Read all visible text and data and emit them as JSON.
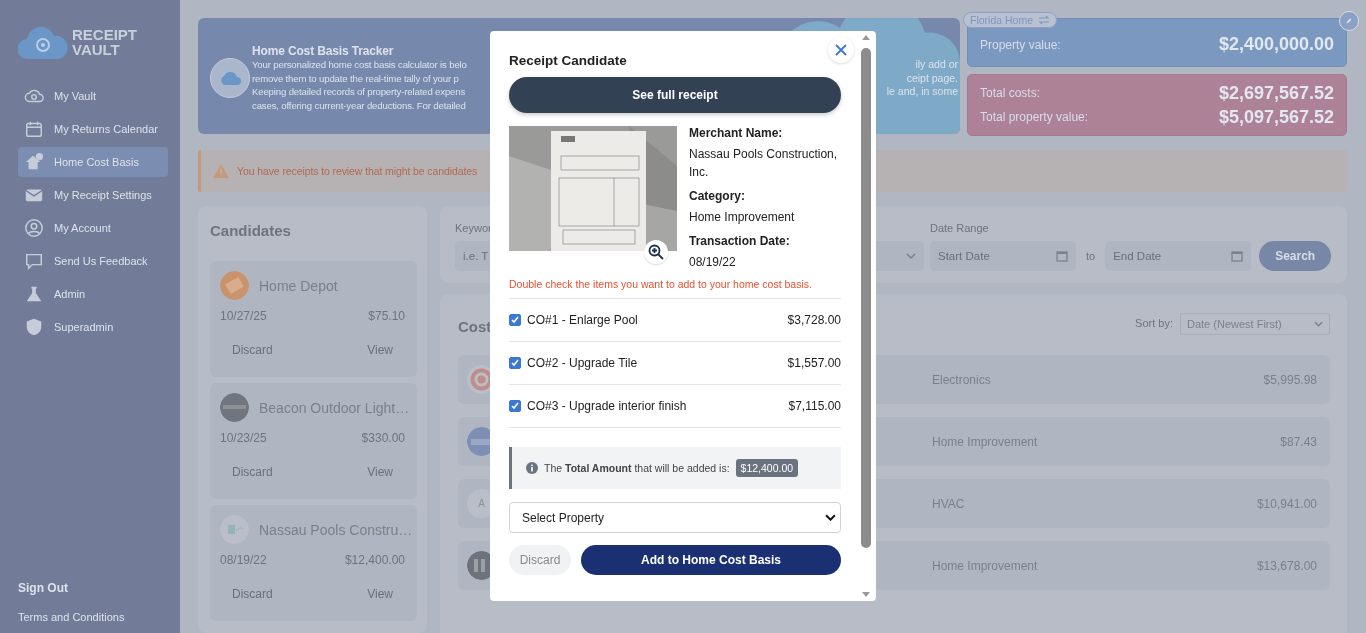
{
  "sidebar": {
    "logo_lines": [
      "RECEIPT",
      "VAULT"
    ],
    "items": [
      {
        "label": "My Vault",
        "kind": "vault",
        "selected": false
      },
      {
        "label": "My Returns Calendar",
        "kind": "calendar",
        "selected": false
      },
      {
        "label": "Home Cost Basis",
        "kind": "house",
        "selected": true
      },
      {
        "label": "My Receipt Settings",
        "kind": "mail",
        "selected": false
      },
      {
        "label": "My Account",
        "kind": "user",
        "selected": false
      },
      {
        "label": "Send Us Feedback",
        "kind": "chat",
        "selected": false
      },
      {
        "label": "Admin",
        "kind": "flask",
        "selected": false
      },
      {
        "label": "Superadmin",
        "kind": "shield",
        "selected": false
      }
    ],
    "sign_out": "Sign Out",
    "terms": "Terms and Conditions"
  },
  "hero": {
    "title": "Home Cost Basis Tracker",
    "lines_left": [
      "Your personalized home cost basis calculator is belo",
      "remove them to update the real-time tally of your p",
      "Keeping detailed records of property-related expens",
      "cases, offering current-year deductions. For detailed"
    ],
    "lines_right": [
      "ily add or",
      "ceipt page.",
      "le and, in some"
    ]
  },
  "property": {
    "name": "Florida Home",
    "value_label": "Property value:",
    "value": "$2,400,000.00",
    "totals": [
      {
        "label": "Total costs:",
        "value": "$2,697,567.52"
      },
      {
        "label": "Total property value:",
        "value": "$5,097,567.52"
      }
    ]
  },
  "alert": {
    "text": "You have receipts to review that might be candidates"
  },
  "candidates": {
    "title": "Candidates",
    "items": [
      {
        "merchant": "Home Depot",
        "kind": "orange",
        "date": "10/27/25",
        "amount": "$75.10",
        "discard": "Discard",
        "view": "View"
      },
      {
        "merchant": "Beacon Outdoor Light…",
        "kind": "dark",
        "date": "10/23/25",
        "amount": "$330.00",
        "discard": "Discard",
        "view": "View"
      },
      {
        "merchant": "Nassau Pools Constru…",
        "kind": "light",
        "date": "08/19/22",
        "amount": "$12,400.00",
        "discard": "Discard",
        "view": "View"
      }
    ]
  },
  "filters": {
    "keyword_label": "Keywor",
    "keyword_placeholder": "i.e. T",
    "date_label": "Date Range",
    "start_placeholder": "Start Date",
    "to": "to",
    "end_placeholder": "End Date",
    "search": "Search"
  },
  "costs": {
    "title": "Cost",
    "sort_label": "Sort by:",
    "sort_value": "Date (Newest First)",
    "rows": [
      {
        "kind": "target",
        "category": "Electronics",
        "amount": "$5,995.98"
      },
      {
        "kind": "blue",
        "category": "Home Improvement",
        "amount": "$87.43"
      },
      {
        "kind": "letter",
        "letter": "A",
        "category": "HVAC",
        "amount": "$10,941.00"
      },
      {
        "kind": "dark",
        "category": "Home Improvement",
        "amount": "$13,678.00"
      }
    ]
  },
  "modal": {
    "title": "Receipt Candidate",
    "full_receipt": "See full receipt",
    "fields": [
      {
        "label": "Merchant Name:",
        "value": "Nassau Pools Construction, Inc."
      },
      {
        "label": "Category:",
        "value": "Home Improvement"
      },
      {
        "label": "Transaction Date:",
        "value": "08/19/22"
      }
    ],
    "note": "Double check the items you want to add to your home cost basis.",
    "items": [
      {
        "name": "CO#1 - Enlarge Pool",
        "amount": "$3,728.00",
        "checked": true
      },
      {
        "name": "CO#2 - Upgrade Tile",
        "amount": "$1,557.00",
        "checked": true
      },
      {
        "name": "CO#3 - Upgrade interior finish",
        "amount": "$7,115.00",
        "checked": true
      }
    ],
    "total_text": "The **Total Amount** that will be added is:",
    "total_amount": "$12,400.00",
    "property_placeholder": "Select Property",
    "discard": "Discard",
    "add": "Add to Home Cost Basis"
  }
}
